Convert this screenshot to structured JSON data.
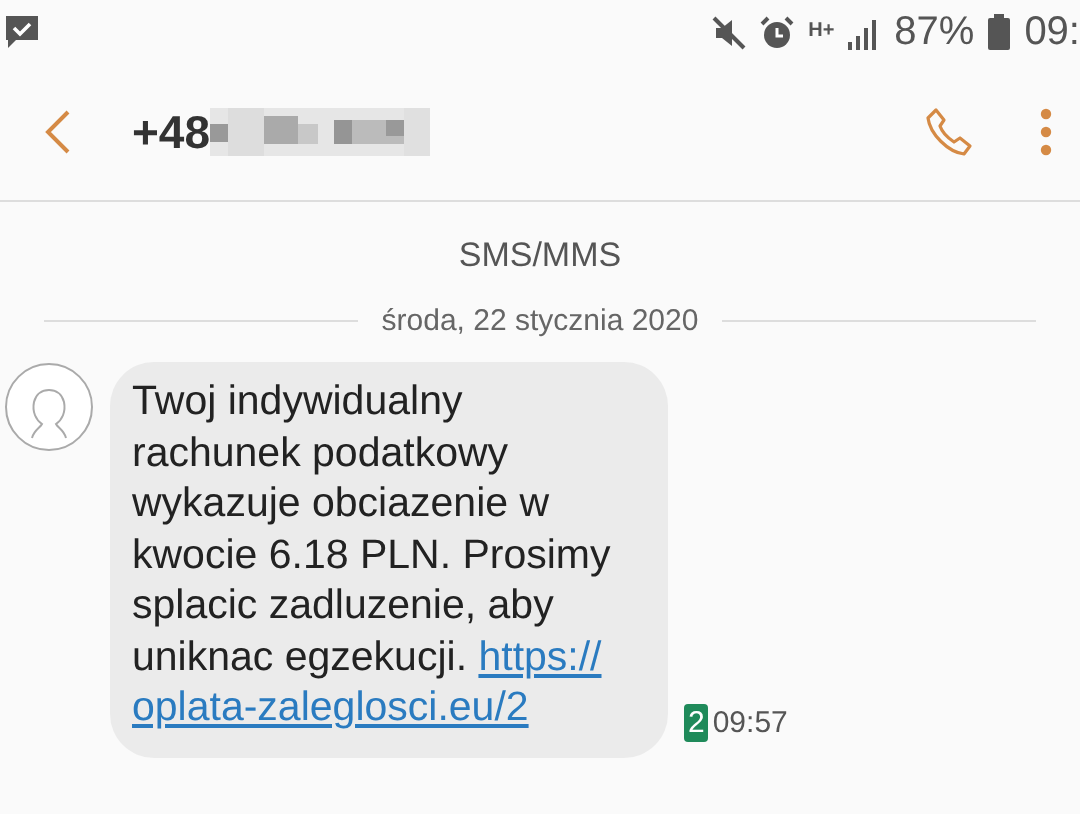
{
  "status_bar": {
    "network": "H+",
    "battery": "87%",
    "time": "09:"
  },
  "header": {
    "contact": "+48"
  },
  "channel_label": "SMS/MMS",
  "date": "środa, 22 stycznia 2020",
  "messages": [
    {
      "text": "Twoj indywidualny rachunek podatkowy wykazuje obciazenie w kwocie 6.18 PLN. Prosimy splacic zadluzenie, aby uniknac egzekucji.",
      "link": [
        "https://",
        "oplata-zaleglosci.eu/2"
      ],
      "sim": "2",
      "time": "09:57"
    }
  ]
}
